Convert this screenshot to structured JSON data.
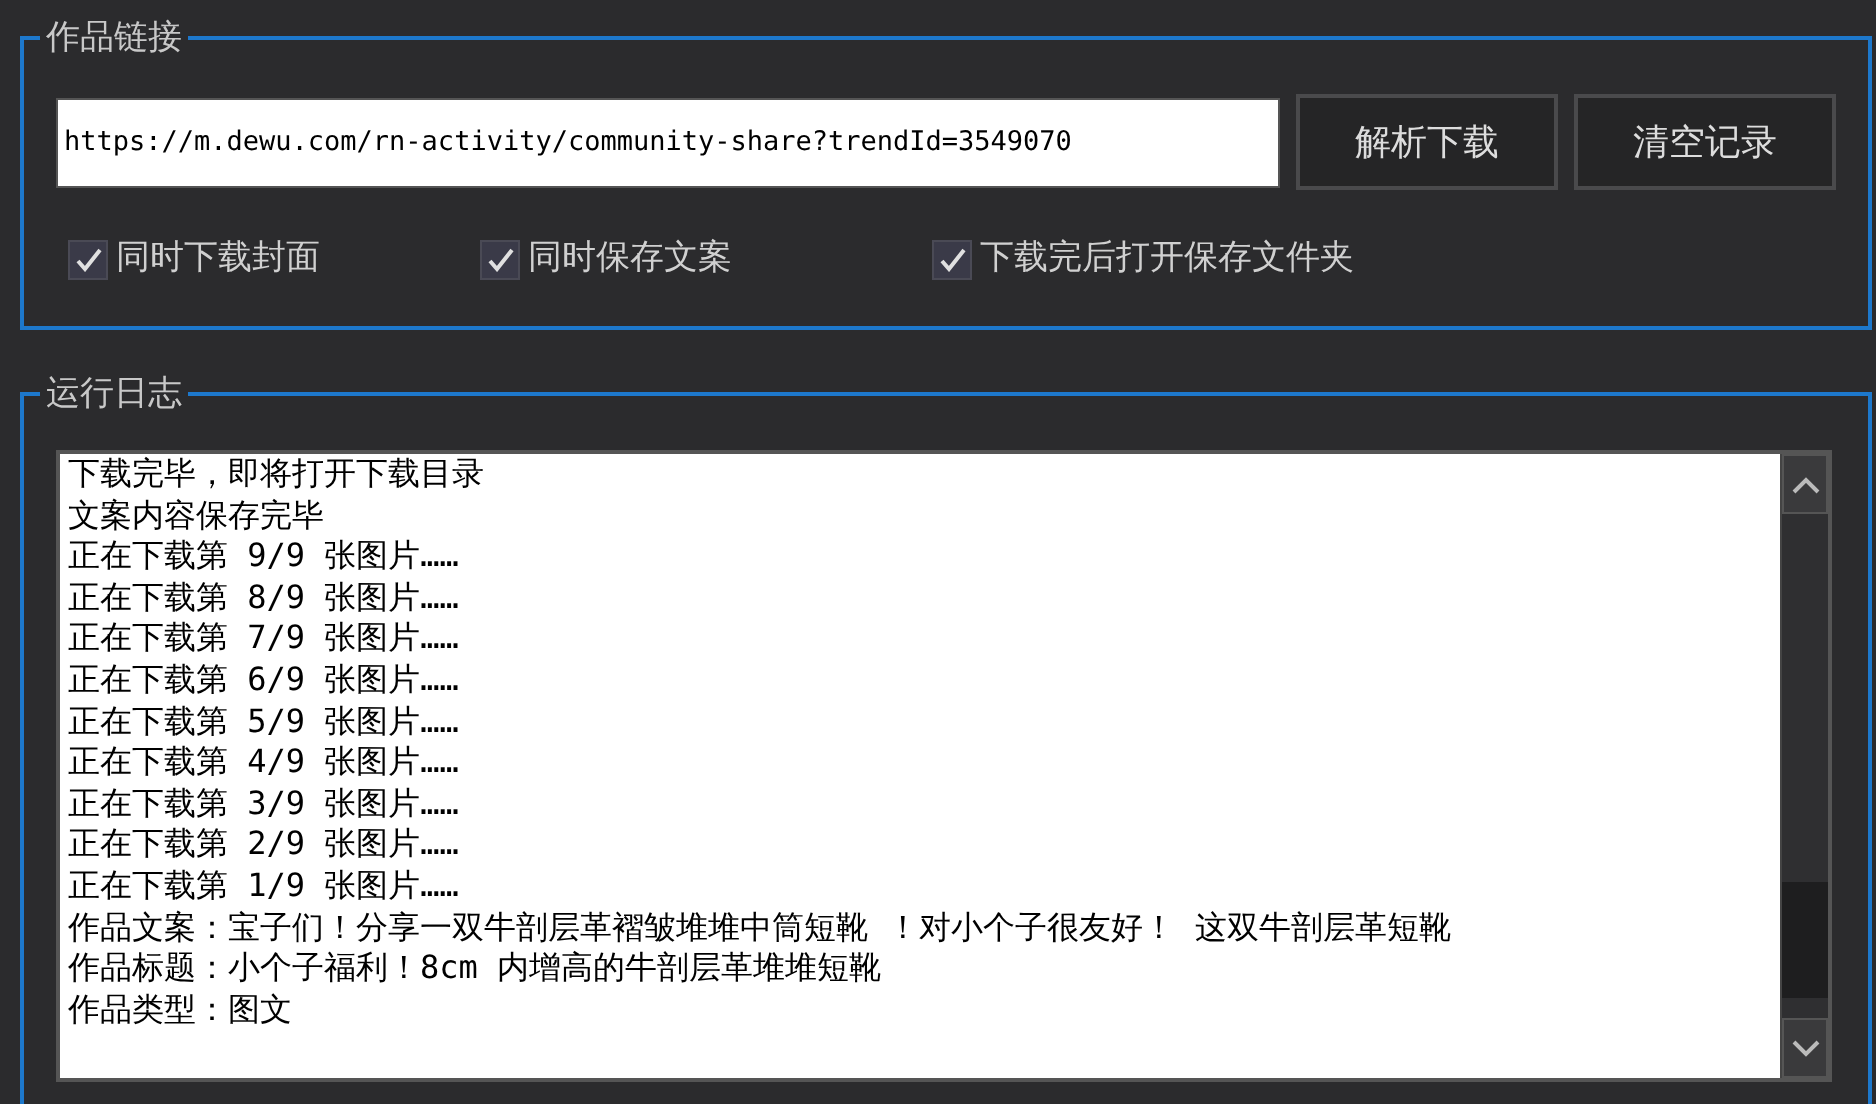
{
  "link_group": {
    "title": "作品链接",
    "url": "https://m.dewu.com/rn-activity/community-share?trendId=3549070",
    "buttons": [
      "解析下载",
      "清空记录"
    ],
    "options": [
      {
        "label": "同时下载封面",
        "checked": true
      },
      {
        "label": "同时保存文案",
        "checked": true
      },
      {
        "label": "下载完后打开保存文件夹",
        "checked": true
      }
    ]
  },
  "log_group": {
    "title": "运行日志",
    "lines": [
      "下载完毕，即将打开下载目录",
      "文案内容保存完毕",
      "正在下载第 9/9 张图片……",
      "正在下载第 8/9 张图片……",
      "正在下载第 7/9 张图片……",
      "正在下载第 6/9 张图片……",
      "正在下载第 5/9 张图片……",
      "正在下载第 4/9 张图片……",
      "正在下载第 3/9 张图片……",
      "正在下载第 2/9 张图片……",
      "正在下载第 1/9 张图片……",
      "作品文案：宝子们！分享一双牛剖层革褶皱堆堆中筒短靴 ！对小个子很友好！ 这双牛剖层革短靴",
      "作品标题：小个子福利！8cm 内增高的牛剖层革堆堆短靴",
      "作品类型：图文"
    ]
  }
}
